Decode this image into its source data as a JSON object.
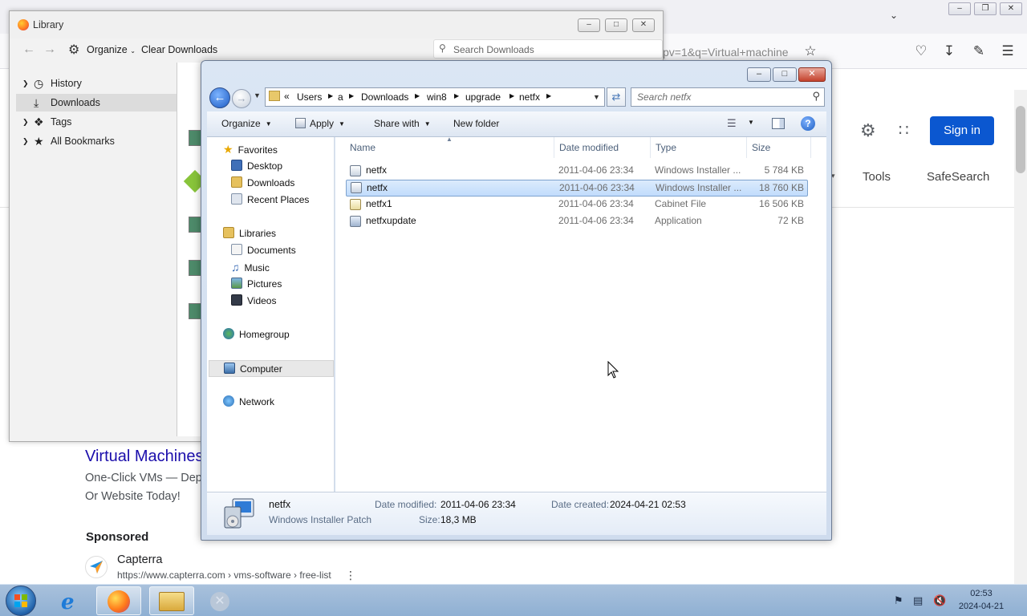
{
  "firefox": {
    "url_fragment": "pv=1&q=Virtual+machine",
    "sign_in": "Sign in",
    "tools": "Tools",
    "safesearch": "SafeSearch"
  },
  "results": {
    "title": "Virtual Machines",
    "desc_line1": "One-Click VMs — Depl",
    "desc_line2": "Or Website Today!",
    "sponsored": "Sponsored",
    "capterra_name": "Capterra",
    "capterra_url": "https://www.capterra.com › vms-software › free-list"
  },
  "library": {
    "title": "Library",
    "organize": "Organize",
    "clear_downloads": "Clear Downloads",
    "search_placeholder": "Search Downloads",
    "sidebar": [
      {
        "label": "History"
      },
      {
        "label": "Downloads"
      },
      {
        "label": "Tags"
      },
      {
        "label": "All Bookmarks"
      }
    ]
  },
  "explorer": {
    "breadcrumb": [
      "Users",
      "a",
      "Downloads",
      "win8",
      "upgrade",
      "netfx"
    ],
    "search_placeholder": "Search netfx",
    "commands": {
      "organize": "Organize",
      "apply": "Apply",
      "share_with": "Share with",
      "new_folder": "New folder"
    },
    "nav": {
      "favorites": "Favorites",
      "desktop": "Desktop",
      "downloads": "Downloads",
      "recent_places": "Recent Places",
      "libraries": "Libraries",
      "documents": "Documents",
      "music": "Music",
      "pictures": "Pictures",
      "videos": "Videos",
      "homegroup": "Homegroup",
      "computer": "Computer",
      "network": "Network"
    },
    "columns": {
      "name": "Name",
      "date_modified": "Date modified",
      "type": "Type",
      "size": "Size"
    },
    "files": [
      {
        "name": "netfx",
        "date": "2011-04-06 23:34",
        "type": "Windows Installer ...",
        "size": "5 784 KB"
      },
      {
        "name": "netfx",
        "date": "2011-04-06 23:34",
        "type": "Windows Installer ...",
        "size": "18 760 KB"
      },
      {
        "name": "netfx1",
        "date": "2011-04-06 23:34",
        "type": "Cabinet File",
        "size": "16 506 KB"
      },
      {
        "name": "netfxupdate",
        "date": "2011-04-06 23:34",
        "type": "Application",
        "size": "72 KB"
      }
    ],
    "details": {
      "name": "netfx",
      "type": "Windows Installer Patch",
      "date_modified_label": "Date modified:",
      "date_modified": "2011-04-06 23:34",
      "size_label": "Size:",
      "size": "18,3 MB",
      "date_created_label": "Date created:",
      "date_created": "2024-04-21 02:53"
    }
  },
  "taskbar": {
    "time": "02:53",
    "date": "2024-04-21"
  }
}
